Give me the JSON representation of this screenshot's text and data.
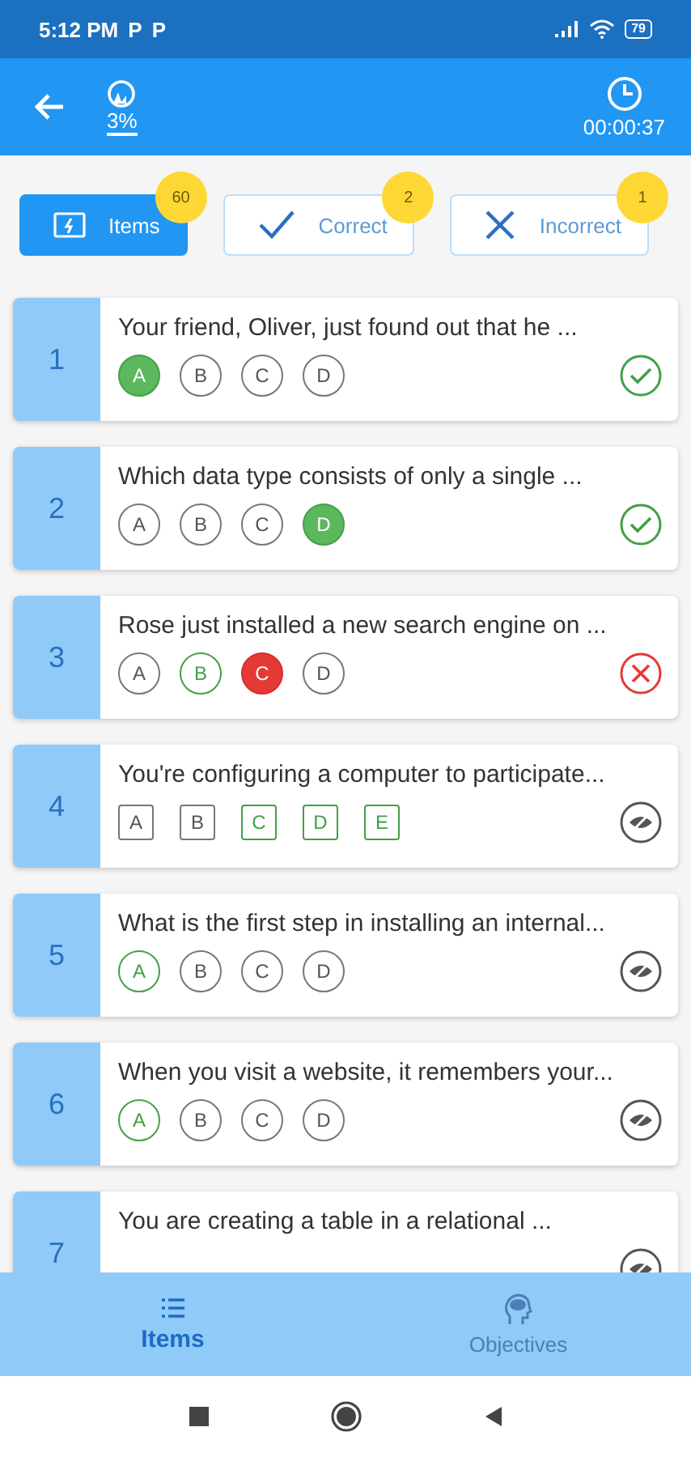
{
  "status_bar": {
    "time": "5:12 PM",
    "notification_icons": [
      "P",
      "P"
    ],
    "battery": "79"
  },
  "header": {
    "progress": "3%",
    "timer": "00:00:37"
  },
  "filters": [
    {
      "kind": "items",
      "label": "Items",
      "count": "60",
      "selected": true
    },
    {
      "kind": "correct",
      "label": "Correct",
      "count": "2",
      "selected": false
    },
    {
      "kind": "incorrect",
      "label": "Incorrect",
      "count": "1",
      "selected": false
    }
  ],
  "questions": [
    {
      "number": "1",
      "text": "Your friend, Oliver, just found out that he ...",
      "kind": "single",
      "answered": true,
      "correct": true,
      "options": [
        {
          "letter": "A",
          "chosen": true,
          "correct": true
        },
        {
          "letter": "B",
          "chosen": false,
          "correct": false
        },
        {
          "letter": "C",
          "chosen": false,
          "correct": false
        },
        {
          "letter": "D",
          "chosen": false,
          "correct": false
        }
      ]
    },
    {
      "number": "2",
      "text": "Which data type consists of only a single ...",
      "kind": "single",
      "answered": true,
      "correct": true,
      "options": [
        {
          "letter": "A",
          "chosen": false,
          "correct": false
        },
        {
          "letter": "B",
          "chosen": false,
          "correct": false
        },
        {
          "letter": "C",
          "chosen": false,
          "correct": false
        },
        {
          "letter": "D",
          "chosen": true,
          "correct": true
        }
      ]
    },
    {
      "number": "3",
      "text": "Rose just installed a new search engine on ...",
      "kind": "single",
      "answered": true,
      "correct": false,
      "options": [
        {
          "letter": "A",
          "chosen": false,
          "correct": false
        },
        {
          "letter": "B",
          "chosen": false,
          "correct": true
        },
        {
          "letter": "C",
          "chosen": true,
          "correct": false
        },
        {
          "letter": "D",
          "chosen": false,
          "correct": false
        }
      ]
    },
    {
      "number": "4",
      "text": "You're configuring a computer to participate...",
      "kind": "multiple",
      "answered": false,
      "options": [
        {
          "letter": "A",
          "chosen": false,
          "correct": false
        },
        {
          "letter": "B",
          "chosen": false,
          "correct": false
        },
        {
          "letter": "C",
          "chosen": false,
          "correct": true
        },
        {
          "letter": "D",
          "chosen": false,
          "correct": true
        },
        {
          "letter": "E",
          "chosen": false,
          "correct": true
        }
      ]
    },
    {
      "number": "5",
      "text": "What is the first step in installing an internal...",
      "kind": "single",
      "answered": false,
      "options": [
        {
          "letter": "A",
          "chosen": false,
          "correct": true
        },
        {
          "letter": "B",
          "chosen": false,
          "correct": false
        },
        {
          "letter": "C",
          "chosen": false,
          "correct": false
        },
        {
          "letter": "D",
          "chosen": false,
          "correct": false
        }
      ]
    },
    {
      "number": "6",
      "text": "When you visit a website, it remembers your...",
      "kind": "single",
      "answered": false,
      "options": [
        {
          "letter": "A",
          "chosen": false,
          "correct": true
        },
        {
          "letter": "B",
          "chosen": false,
          "correct": false
        },
        {
          "letter": "C",
          "chosen": false,
          "correct": false
        },
        {
          "letter": "D",
          "chosen": false,
          "correct": false
        }
      ]
    },
    {
      "number": "7",
      "text": "You are creating a table in a relational ...",
      "answered": false
    }
  ],
  "bottom_nav": [
    {
      "kind": "items",
      "label": "Items",
      "selected": true
    },
    {
      "kind": "objectives",
      "label": "Objectives",
      "selected": false
    }
  ]
}
